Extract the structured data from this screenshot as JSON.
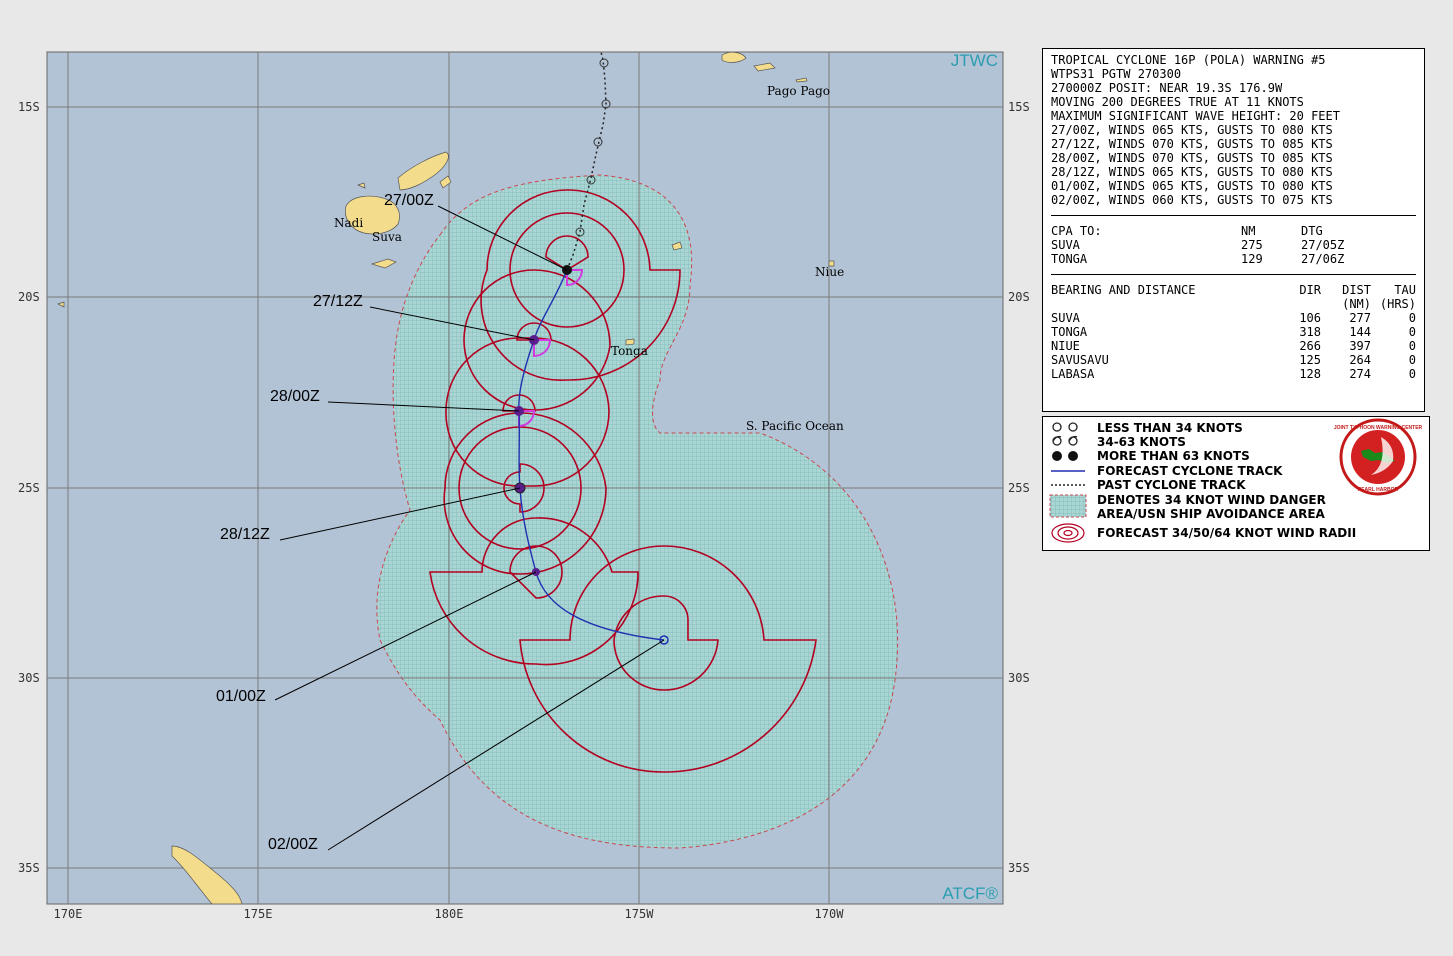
{
  "map": {
    "watermark_top": "JTWC",
    "watermark_bottom": "ATCF®",
    "lat_labels": [
      "15S",
      "20S",
      "25S",
      "30S",
      "35S"
    ],
    "lon_labels": [
      "170E",
      "175E",
      "180E",
      "175W",
      "170W"
    ],
    "place_labels": {
      "pago_pago": "Pago Pago",
      "nadi": "Nadi",
      "suva": "Suva",
      "niue": "Niue",
      "tonga": "Tonga",
      "ocean": "S. Pacific Ocean"
    },
    "forecast_labels": [
      "27/00Z",
      "27/12Z",
      "28/00Z",
      "28/12Z",
      "01/00Z",
      "02/00Z"
    ],
    "colors": {
      "ocean": "#b3c3d6",
      "land": "#f3dc8c",
      "danger_area": "#9fd0cf",
      "wind_radii": "#b30021",
      "track": "#1f2fb0",
      "storm_icon": "#5a1e8c",
      "initial_radii": "#d13be0"
    }
  },
  "warning": {
    "header_lines": [
      "TROPICAL CYCLONE 16P (POLA) WARNING #5",
      "WTPS31 PGTW 270300",
      "270000Z POSIT: NEAR 19.3S 176.9W",
      "MOVING 200 DEGREES TRUE AT 11 KNOTS",
      "MAXIMUM SIGNIFICANT WAVE HEIGHT: 20 FEET",
      "27/00Z, WINDS 065 KTS, GUSTS TO 080 KTS",
      "27/12Z, WINDS 070 KTS, GUSTS TO 085 KTS",
      "28/00Z, WINDS 070 KTS, GUSTS TO 085 KTS",
      "28/12Z, WINDS 065 KTS, GUSTS TO 080 KTS",
      "01/00Z, WINDS 065 KTS, GUSTS TO 080 KTS",
      "02/00Z, WINDS 060 KTS, GUSTS TO 075 KTS"
    ],
    "cpa": {
      "title": "CPA TO:",
      "col_nm": "NM",
      "col_dtg": "DTG",
      "rows": [
        {
          "name": "SUVA",
          "nm": "275",
          "dtg": "27/05Z"
        },
        {
          "name": "TONGA",
          "nm": "129",
          "dtg": "27/06Z"
        }
      ]
    },
    "bearing": {
      "title": "BEARING AND DISTANCE",
      "col_dir": "DIR",
      "col_dist": "DIST",
      "col_tau": "TAU",
      "col_dist_unit": "(NM)",
      "col_tau_unit": "(HRS)",
      "rows": [
        {
          "name": "SUVA",
          "dir": "106",
          "dist": "277",
          "tau": "0"
        },
        {
          "name": "TONGA",
          "dir": "318",
          "dist": "144",
          "tau": "0"
        },
        {
          "name": "NIUE",
          "dir": "266",
          "dist": "397",
          "tau": "0"
        },
        {
          "name": "SAVUSAVU",
          "dir": "125",
          "dist": "264",
          "tau": "0"
        },
        {
          "name": "LABASA",
          "dir": "128",
          "dist": "274",
          "tau": "0"
        }
      ]
    }
  },
  "legend": {
    "items": [
      "LESS THAN 34 KNOTS",
      "34-63 KNOTS",
      "MORE THAN 63 KNOTS",
      "FORECAST CYCLONE TRACK",
      "PAST CYCLONE TRACK",
      "DENOTES 34 KNOT WIND DANGER",
      "AREA/USN SHIP AVOIDANCE AREA",
      "FORECAST 34/50/64 KNOT WIND RADII"
    ],
    "seal_text": "JOINT TYPHOON WARNING CENTER",
    "seal_sub": "PEARL HARBOR"
  }
}
